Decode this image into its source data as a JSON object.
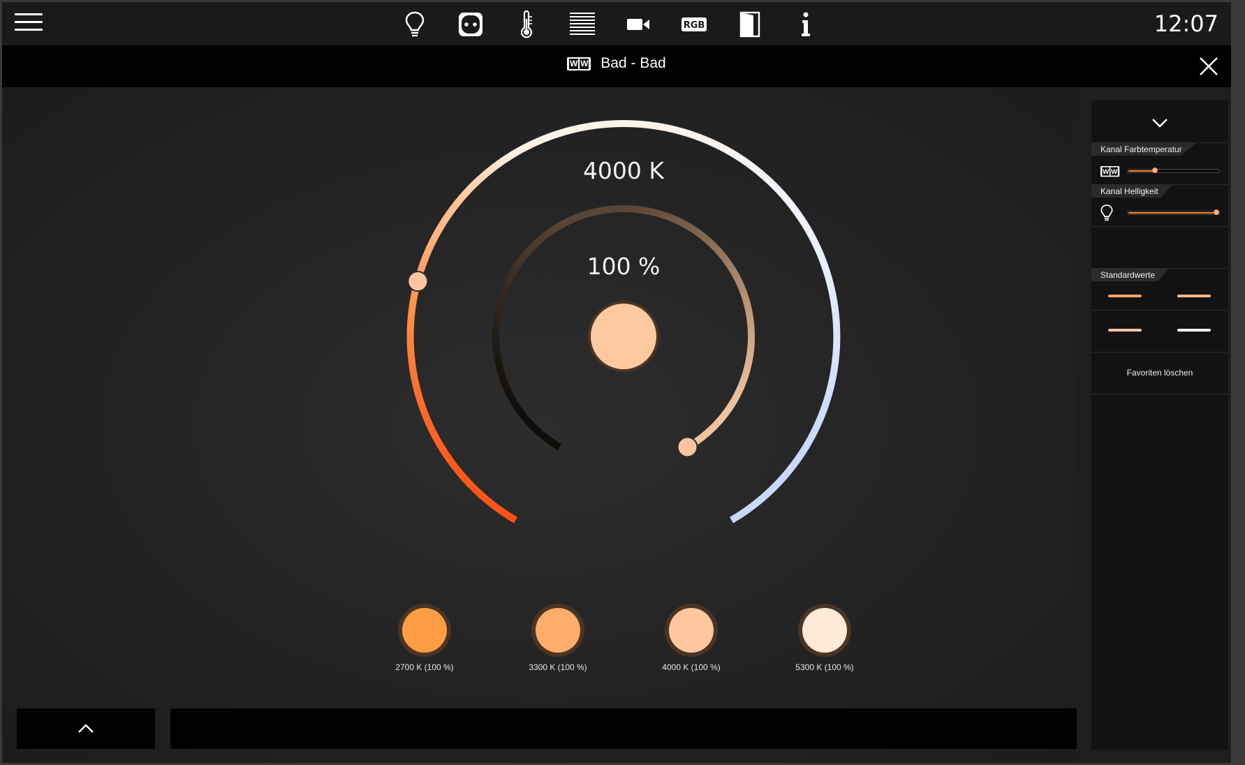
{
  "topbar": {
    "clock": "12:07",
    "categories": [
      {
        "name": "light",
        "icon": "bulb-icon"
      },
      {
        "name": "socket",
        "icon": "socket-icon"
      },
      {
        "name": "temperature",
        "icon": "thermometer-icon"
      },
      {
        "name": "blinds",
        "icon": "blinds-icon"
      },
      {
        "name": "camera",
        "icon": "camera-icon"
      },
      {
        "name": "rgb",
        "icon": "rgb-icon",
        "text": "RGB"
      },
      {
        "name": "door",
        "icon": "door-icon"
      },
      {
        "name": "info",
        "icon": "info-icon"
      }
    ]
  },
  "titlebar": {
    "badge": "WW",
    "title": "Bad - Bad"
  },
  "dial": {
    "temperature_label": "4000 K",
    "temperature_k": 4000,
    "temperature_fraction": 0.25,
    "brightness_label": "100 %",
    "brightness_percent": 100,
    "current_color": "#ffc9a0"
  },
  "presets": [
    {
      "label": "2700 K (100 %)",
      "color": "#ff9d45"
    },
    {
      "label": "3300 K (100 %)",
      "color": "#ffad6b"
    },
    {
      "label": "4000 K (100 %)",
      "color": "#ffc79e"
    },
    {
      "label": "5300 K (100 %)",
      "color": "#ffe9d8"
    }
  ],
  "side": {
    "rows": [
      {
        "label": "Kanal Farbtemperatur",
        "icon": "ww-icon",
        "value_fraction": 0.3
      },
      {
        "label": "Kanal Helligkeit",
        "icon": "bulb-icon",
        "value_fraction": 1.0
      }
    ],
    "defaults_label": "Standardwerte",
    "favorites": [
      {
        "color": "#f3a26a"
      },
      {
        "color": "#f6b88a"
      },
      {
        "color": "#f5c3a2"
      },
      {
        "color": "#ffffff"
      }
    ],
    "delete_favorites_label": "Favoriten löschen"
  },
  "colors": {
    "accent": "#ff8a3a",
    "background": "#1e1e1e",
    "bar": "#000000"
  }
}
